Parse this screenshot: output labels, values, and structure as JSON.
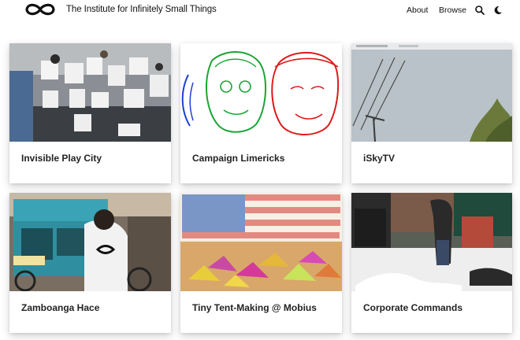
{
  "header": {
    "site_title": "The Institute for Infinitely Small Things",
    "nav": {
      "about": "About",
      "browse": "Browse"
    },
    "icons": {
      "logo": "infinity-logo",
      "search": "search-icon",
      "theme": "moon-icon"
    }
  },
  "projects": [
    {
      "title": "Invisible Play City",
      "image": "protest-signs-photo"
    },
    {
      "title": "Campaign Limericks",
      "image": "candidate-line-drawings"
    },
    {
      "title": "iSkyTV",
      "image": "sky-webcam-screenshot"
    },
    {
      "title": "Zamboanga Hace",
      "image": "tricycle-photo"
    },
    {
      "title": "Tiny Tent-Making @ Mobius",
      "image": "tent-installation-photo"
    },
    {
      "title": "Corporate Commands",
      "image": "snow-street-performance-photo"
    }
  ]
}
